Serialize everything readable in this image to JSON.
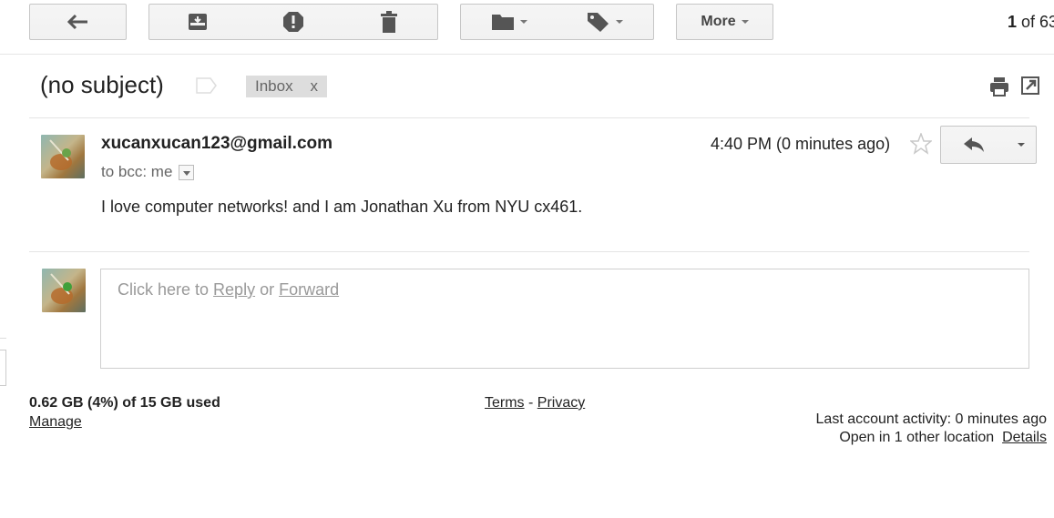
{
  "toolbar": {
    "more_label": "More",
    "pager_current": "1",
    "pager_text": " of 63"
  },
  "message": {
    "subject": "(no subject)",
    "label": "Inbox",
    "label_remove": "x",
    "sender": "xucanxucan123@gmail.com",
    "to_line": "to bcc: me",
    "time": "4:40 PM (0 minutes ago)",
    "body": "I love computer networks! and I am Jonathan Xu from NYU cx461."
  },
  "reply": {
    "prefix": "Click here to ",
    "reply_link": "Reply",
    "middle": " or ",
    "forward_link": "Forward"
  },
  "footer": {
    "storage": "0.62 GB (4%) of 15 GB used",
    "manage": "Manage",
    "terms": "Terms",
    "separator": " - ",
    "privacy": "Privacy",
    "activity": "Last account activity: 0 minutes ago",
    "open_locations": "Open in 1 other location",
    "details": "Details"
  }
}
